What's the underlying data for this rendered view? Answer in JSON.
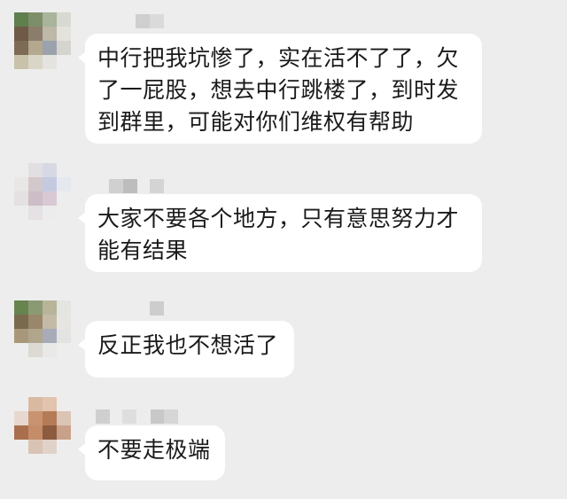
{
  "messages": [
    {
      "lines": [
        "中行把我坑惨了，实在活不了了，欠",
        "了一屁股，想去中行跳楼了，到时发",
        "到群里，可能对你们维权有帮助"
      ]
    },
    {
      "lines": [
        "大家不要各个地方，只有意思努力才",
        "能有结果"
      ]
    },
    {
      "lines": [
        "反正我也不想活了"
      ]
    },
    {
      "lines": [
        "不要走极端"
      ]
    }
  ],
  "colors": {
    "background": "#ededed",
    "bubble": "#ffffff",
    "text": "#1a1a1a"
  }
}
